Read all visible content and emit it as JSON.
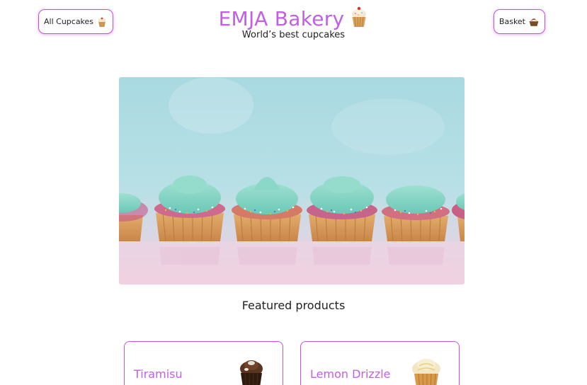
{
  "nav": {
    "all_cupcakes_label": "All Cupcakes",
    "all_cupcakes_icon": "cupcake-icon",
    "basket_label": "Basket",
    "basket_icon": "basket-icon"
  },
  "header": {
    "title": "EMJA Bakery",
    "title_icon": "cupcake-icon",
    "tagline": "World’s best cupcakes"
  },
  "hero": {
    "image": "row-of-mint-frosted-cupcakes-with-sprinkles"
  },
  "featured": {
    "heading": "Featured products",
    "products": [
      {
        "name": "Tiramisu",
        "icon": "chocolate-cupcake-icon"
      },
      {
        "name": "Lemon Drizzle",
        "icon": "lemon-cupcake-icon"
      }
    ]
  },
  "colors": {
    "accent": "#c451e0",
    "title": "#c35fe2",
    "frosting": "#7fd3c4",
    "cake": "#d79a5c"
  }
}
